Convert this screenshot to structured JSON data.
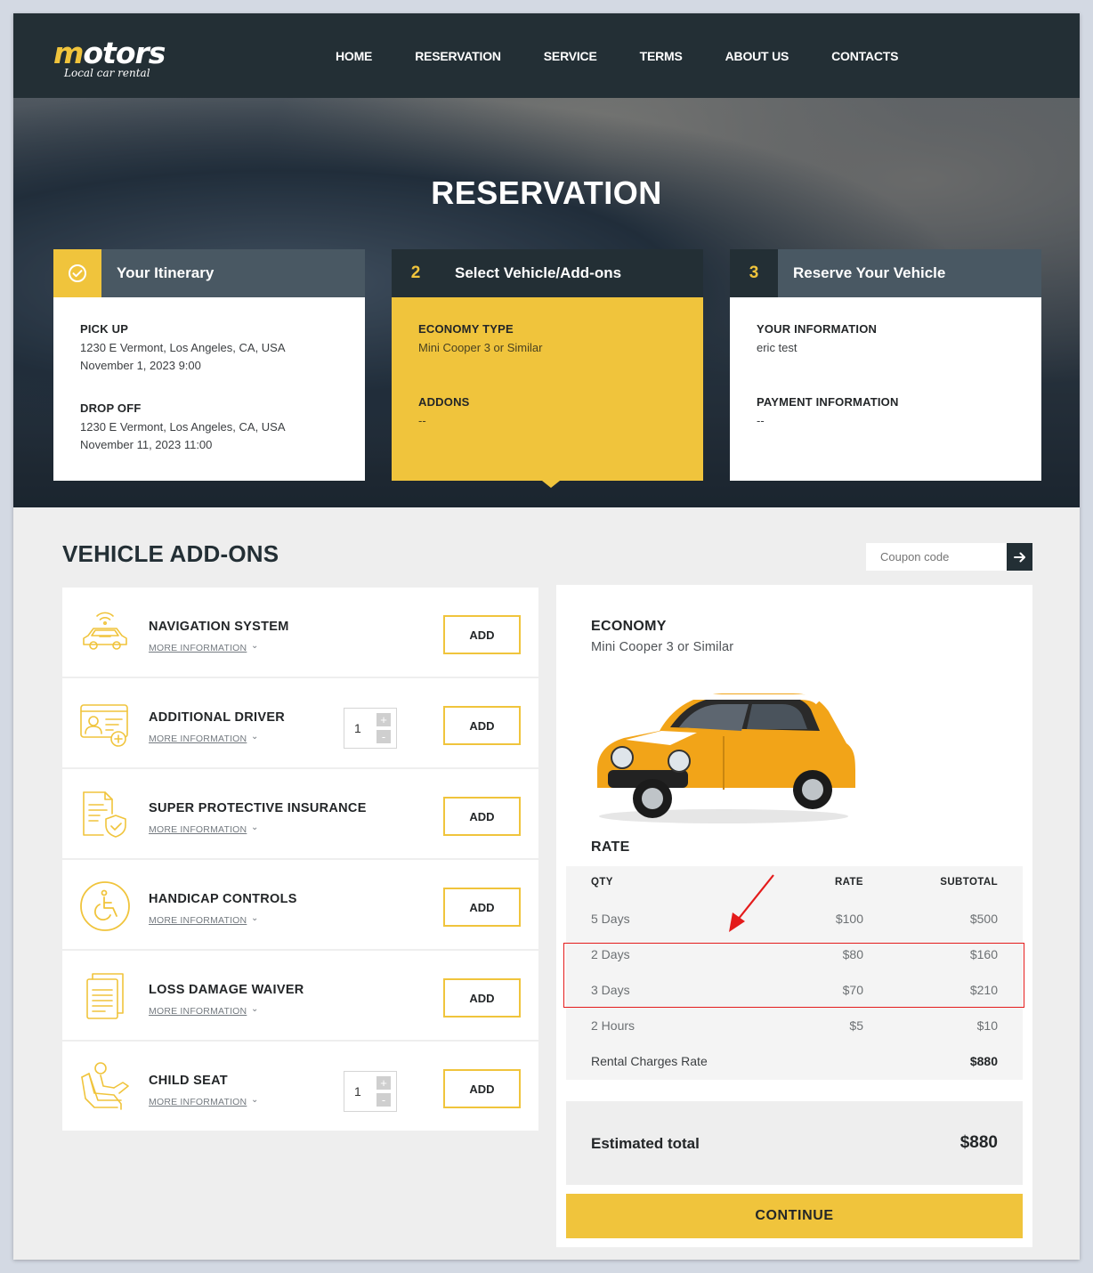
{
  "brand": {
    "name_m": "m",
    "name_rest": "otors",
    "tagline": "Local car rental"
  },
  "nav": {
    "items": [
      "HOME",
      "RESERVATION",
      "SERVICE",
      "TERMS",
      "ABOUT US",
      "CONTACTS"
    ]
  },
  "hero": {
    "title": "RESERVATION"
  },
  "steps": [
    {
      "number": "",
      "title": "Your Itinerary",
      "sections": [
        {
          "label": "PICK UP",
          "lines": [
            "1230 E Vermont, Los Angeles, CA, USA",
            "November 1, 2023 9:00"
          ]
        },
        {
          "label": "DROP OFF",
          "lines": [
            "1230 E Vermont, Los Angeles, CA, USA",
            "November 11, 2023 11:00"
          ]
        }
      ]
    },
    {
      "number": "2",
      "title": "Select Vehicle/Add-ons",
      "sections": [
        {
          "label": "ECONOMY TYPE",
          "lines": [
            "Mini Cooper 3 or Similar"
          ]
        },
        {
          "label": "ADDONS",
          "lines": [
            "--"
          ]
        }
      ]
    },
    {
      "number": "3",
      "title": "Reserve Your Vehicle",
      "sections": [
        {
          "label": "YOUR INFORMATION",
          "lines": [
            "eric test"
          ]
        },
        {
          "label": "PAYMENT INFORMATION",
          "lines": [
            "--"
          ]
        }
      ]
    }
  ],
  "addons_section": {
    "title": "VEHICLE ADD-ONS",
    "coupon_placeholder": "Coupon code",
    "more_info_label": "MORE INFORMATION",
    "add_label": "ADD",
    "items": [
      {
        "name": "NAVIGATION SYSTEM",
        "icon": "navigation-car-icon",
        "qty": null
      },
      {
        "name": "ADDITIONAL DRIVER",
        "icon": "driver-license-icon",
        "qty": "1"
      },
      {
        "name": "SUPER PROTECTIVE INSURANCE",
        "icon": "insurance-document-icon",
        "qty": null
      },
      {
        "name": "HANDICAP CONTROLS",
        "icon": "wheelchair-icon",
        "qty": null
      },
      {
        "name": "LOSS DAMAGE WAIVER",
        "icon": "documents-icon",
        "qty": null
      },
      {
        "name": "CHILD SEAT",
        "icon": "child-seat-icon",
        "qty": "1"
      }
    ]
  },
  "summary": {
    "type": "ECONOMY",
    "model": "Mini Cooper 3 or Similar",
    "rate_title": "RATE",
    "headers": {
      "qty": "QTY",
      "rate": "RATE",
      "subtotal": "SUBTOTAL"
    },
    "rows": [
      {
        "qty": "5 Days",
        "rate": "$100",
        "subtotal": "$500"
      },
      {
        "qty": "2 Days",
        "rate": "$80",
        "subtotal": "$160"
      },
      {
        "qty": "3 Days",
        "rate": "$70",
        "subtotal": "$210"
      },
      {
        "qty": "2 Hours",
        "rate": "$5",
        "subtotal": "$10"
      }
    ],
    "charges_label": "Rental Charges Rate",
    "charges_value": "$880",
    "estimated_label": "Estimated total",
    "estimated_value": "$880",
    "continue_label": "CONTINUE"
  },
  "colors": {
    "accent": "#f0c43c",
    "dark": "#232f35",
    "highlight": "#e41b1b"
  }
}
